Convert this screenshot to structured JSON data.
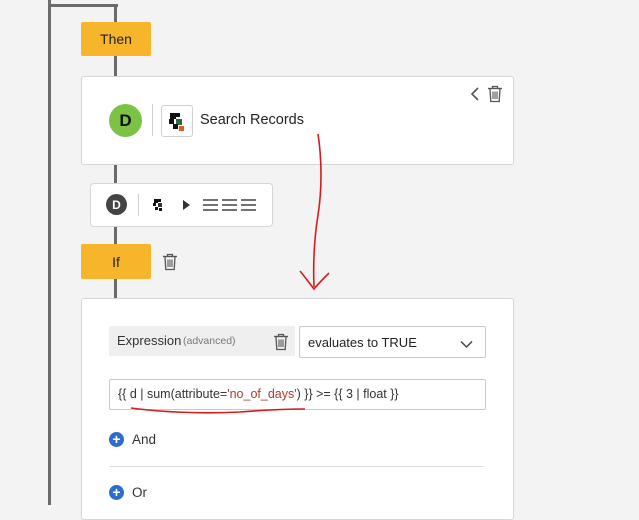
{
  "then_block": {
    "label": "Then"
  },
  "search_card": {
    "avatar_letter": "D",
    "action_label": "Search Records"
  },
  "mini_toolbar": {
    "avatar_letter": "D"
  },
  "if_block": {
    "label": "If"
  },
  "condition": {
    "expression_label": "Expression",
    "expression_hint": "(advanced)",
    "operator_value": "evaluates to TRUE",
    "expression_parts": {
      "part1": "{{ d | sum(attribute=",
      "string_literal": "'no_of_days'",
      "part2": ") }} >= {{ 3 | float }}"
    },
    "and_label": "And",
    "or_label": "Or"
  },
  "colors": {
    "pill": "#f7b52c",
    "avatar_green": "#7cc244",
    "avatar_dark": "#444444",
    "plus_blue": "#2d6ccf",
    "annotation_red": "#d41c1c",
    "string_red": "#b03a2e"
  },
  "icons": {
    "collapse": "chevron-left-icon",
    "delete": "trash-icon",
    "select_caret": "chevron-down-icon",
    "play": "play-icon",
    "list": "list-icon",
    "add": "plus-circle-icon"
  }
}
